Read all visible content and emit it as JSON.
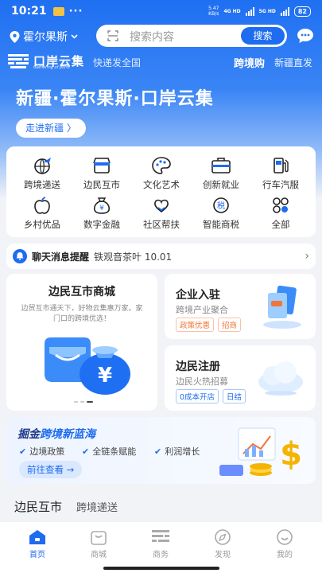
{
  "status_bar": {
    "time": "10:21",
    "speed_value": "5.47",
    "speed_unit": "KB/s",
    "network_1": "4G HD",
    "network_2": "5G HD",
    "battery": "82"
  },
  "header": {
    "location": "霍尔果斯",
    "search_placeholder": "搜索内容",
    "search_button": "搜索"
  },
  "brand": {
    "name": "口岸云集",
    "subtitle": "Gathering of ports",
    "slogan": "快递发全国",
    "right_primary": "跨境购",
    "right_secondary": "新疆直发"
  },
  "hero": {
    "title": "新疆·霍尔果斯·口岸云集",
    "button": "走进新疆 〉"
  },
  "services": [
    {
      "label": "跨境递送",
      "icon": "plane-globe-icon"
    },
    {
      "label": "边民互市",
      "icon": "storefront-icon"
    },
    {
      "label": "文化艺术",
      "icon": "palette-icon"
    },
    {
      "label": "创新就业",
      "icon": "briefcase-icon"
    },
    {
      "label": "行车汽服",
      "icon": "gas-pump-icon"
    },
    {
      "label": "乡村优品",
      "icon": "apple-icon"
    },
    {
      "label": "数字金融",
      "icon": "money-bag-icon"
    },
    {
      "label": "社区帮扶",
      "icon": "heart-hands-icon"
    },
    {
      "label": "智能商税",
      "icon": "tax-icon"
    },
    {
      "label": "全部",
      "icon": "grid-icon"
    }
  ],
  "notice": {
    "title": "聊天消息提醒",
    "text": "铁观音茶叶 10.01"
  },
  "mall": {
    "title": "边民互市商城",
    "subtitle": "边贸互市通天下，好物云集惠万家。家门口的跨境优选！",
    "currency_symbol": "¥"
  },
  "enterprise": {
    "title": "企业入驻",
    "subtitle": "跨境产业聚合",
    "tags": [
      "政策优惠",
      "招商"
    ]
  },
  "register": {
    "title": "边民注册",
    "subtitle": "边民火热招募",
    "tags": [
      "0成本开店",
      "日结"
    ]
  },
  "banner": {
    "title_part1": "掘金",
    "title_part2": "跨境新蓝海",
    "features": [
      "边境政策",
      "全链条赋能",
      "利润增长"
    ],
    "button": "前往查看 →"
  },
  "section_tabs": [
    "边民互市",
    "跨境递送"
  ],
  "tabbar": [
    {
      "label": "首页",
      "active": true
    },
    {
      "label": "商城",
      "active": false
    },
    {
      "label": "商务",
      "active": false
    },
    {
      "label": "发现",
      "active": false
    },
    {
      "label": "我的",
      "active": false
    }
  ],
  "colors": {
    "primary": "#1e6cf0",
    "accent_orange": "#f0763a",
    "text_dark": "#222222"
  }
}
